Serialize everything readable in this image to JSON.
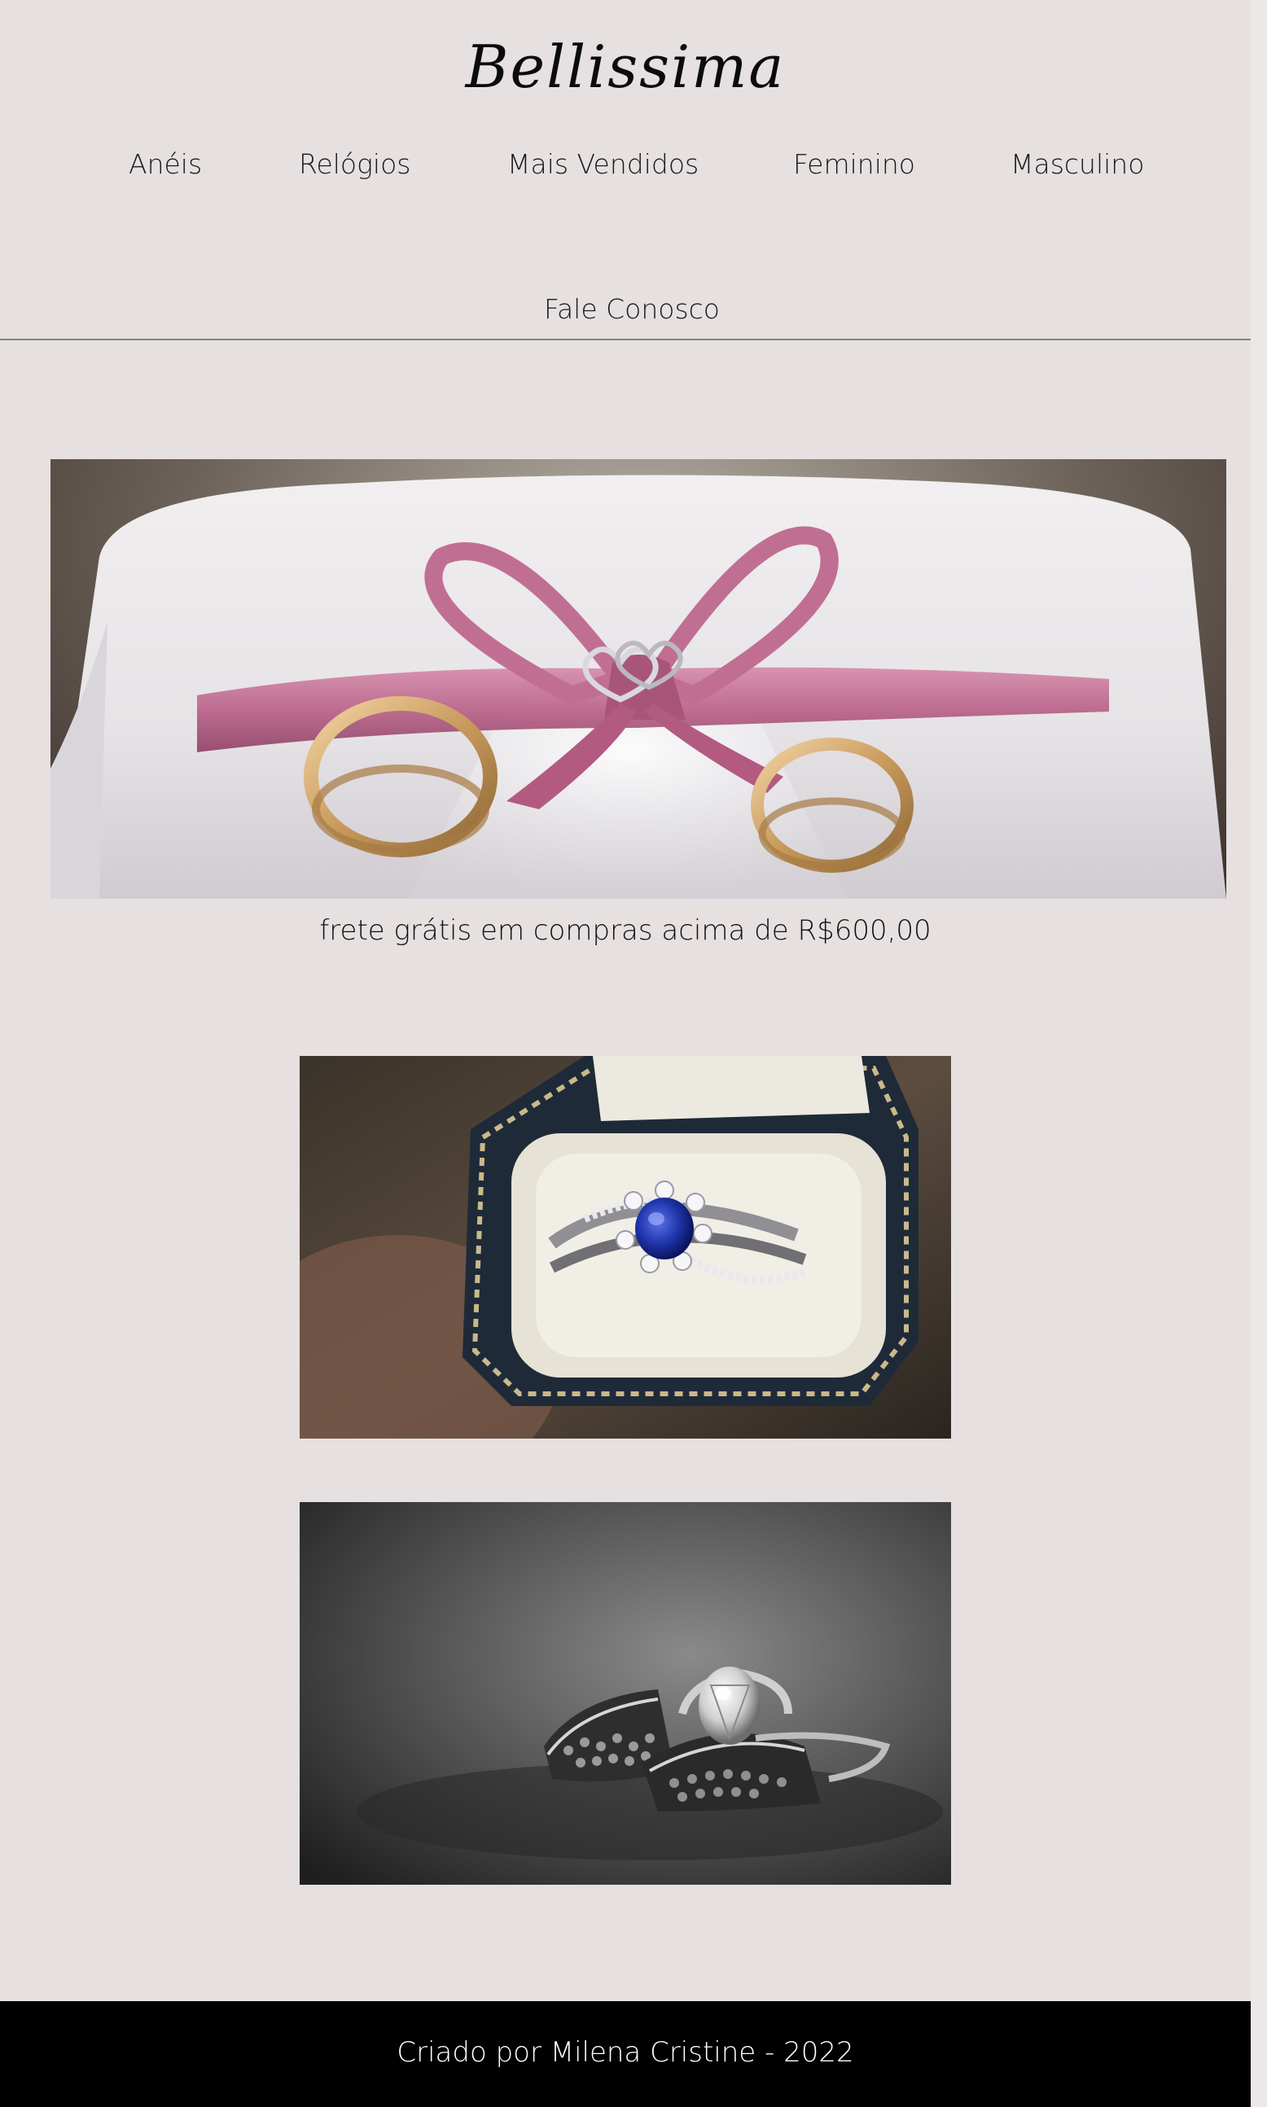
{
  "header": {
    "brand": "Bellissima"
  },
  "nav": {
    "items": [
      {
        "label": "Anéis"
      },
      {
        "label": "Relógios"
      },
      {
        "label": "Mais Vendidos"
      },
      {
        "label": "Feminino"
      },
      {
        "label": "Masculino"
      }
    ],
    "contact_label": "Fale Conosco"
  },
  "banner": {
    "shipping_text": "frete grátis em compras acima de R$600,00"
  },
  "footer": {
    "credit": "Criado por Milena Cristine - 2022",
    "background_color": "#000000"
  },
  "colors": {
    "page_background": "#e6e0e0",
    "divider": "#7d8a87",
    "ribbon": "#b85f86",
    "gold": "#c89a5c",
    "sapphire": "#1e33a8"
  }
}
